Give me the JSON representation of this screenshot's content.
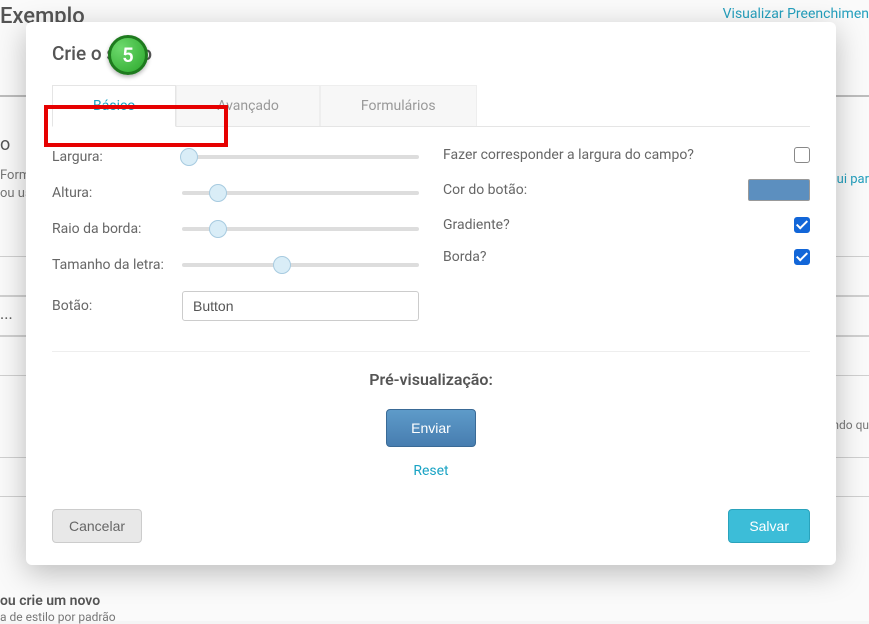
{
  "background": {
    "title": "Exemplo",
    "topLink": "Visualizar Preenchimen",
    "midLink": "qui par",
    "letter": "o",
    "formFrag": "Form",
    "formFrag2": "ou us",
    "dots": "...",
    "rightSmall": "endo qu",
    "bottom1": "ou crie um novo",
    "bottom2": "a de estilo por padrão"
  },
  "modal": {
    "title": "Crie o se              ão",
    "stepBadge": "5",
    "tabs": {
      "basic": "Básico",
      "advanced": "Avançado",
      "forms": "Formulários"
    },
    "labels": {
      "width": "Largura:",
      "height": "Altura:",
      "borderRadius": "Raio da borda:",
      "fontSize": "Tamanho da letra:",
      "button": "Botão:",
      "matchField": "Fazer corresponder a largura do campo?",
      "buttonColor": "Cor do botão:",
      "gradient": "Gradiente?",
      "border": "Borda?"
    },
    "values": {
      "buttonText": "Button",
      "widthPct": 3,
      "heightPct": 15,
      "borderRadiusPct": 15,
      "fontSizePct": 42,
      "matchField": false,
      "gradient": true,
      "border": true,
      "colorHex": "#5c8fbf"
    },
    "preview": {
      "title": "Pré-visualização:",
      "submit": "Enviar",
      "reset": "Reset"
    },
    "footer": {
      "cancel": "Cancelar",
      "save": "Salvar"
    }
  }
}
